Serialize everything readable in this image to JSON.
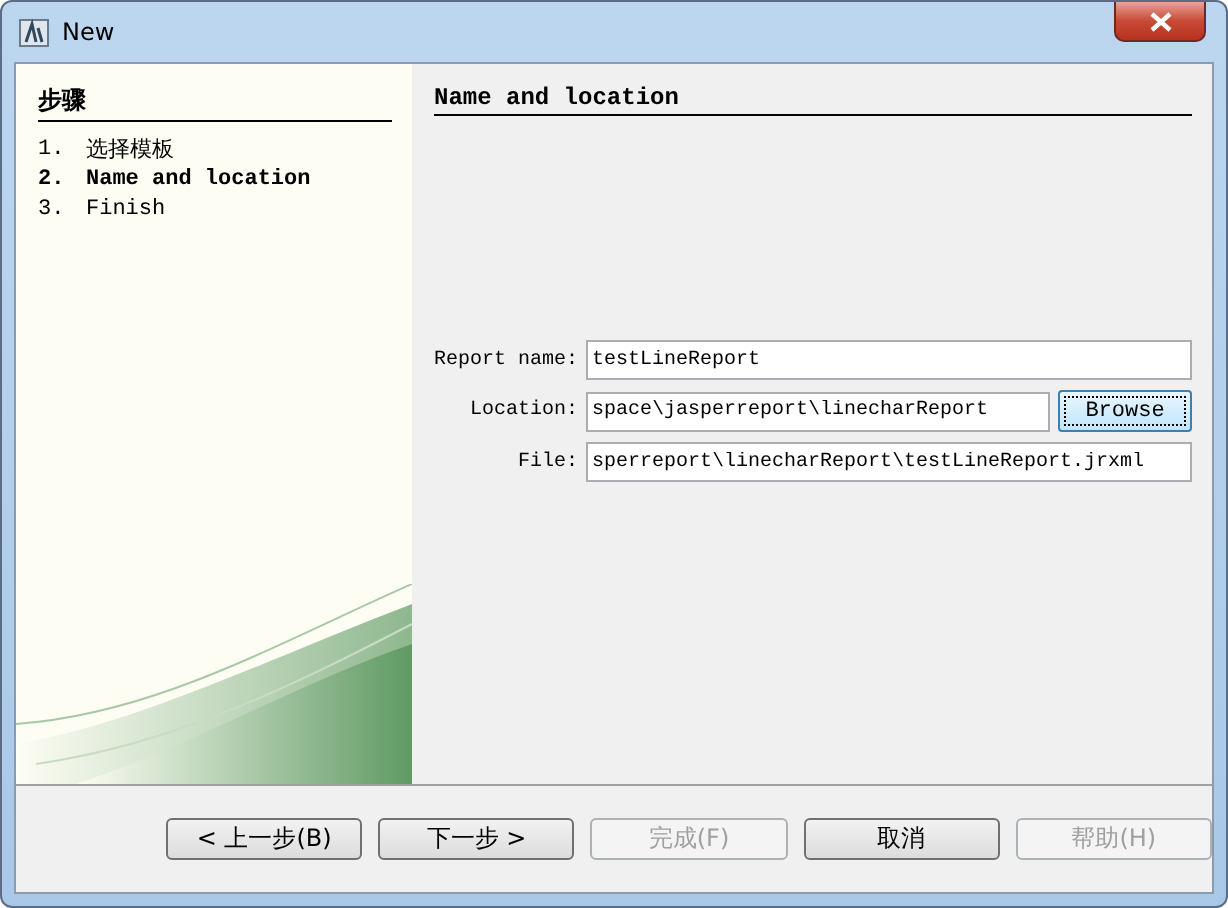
{
  "window": {
    "title": "New"
  },
  "steps": {
    "title": "步骤",
    "items": [
      {
        "number": "1.",
        "label": "选择模板",
        "selected": false
      },
      {
        "number": "2.",
        "label": "Name and location",
        "selected": true
      },
      {
        "number": "3.",
        "label": "Finish",
        "selected": false
      }
    ]
  },
  "panel": {
    "title": "Name and location",
    "fields": [
      {
        "label": "Report name:",
        "value": "testLineReport"
      },
      {
        "label": "Location:",
        "value": "space\\jasperreport\\linecharReport",
        "button": "Browse"
      },
      {
        "label": "File:",
        "value": "sperreport\\linecharReport\\testLineReport.jrxml"
      }
    ]
  },
  "buttons": [
    {
      "label": "< 上一步(B)",
      "disabled": false
    },
    {
      "label": "下一步 >",
      "disabled": false
    },
    {
      "label": "完成(F)",
      "disabled": true
    },
    {
      "label": "取消",
      "disabled": false
    },
    {
      "label": "帮助(H)",
      "disabled": true
    }
  ]
}
